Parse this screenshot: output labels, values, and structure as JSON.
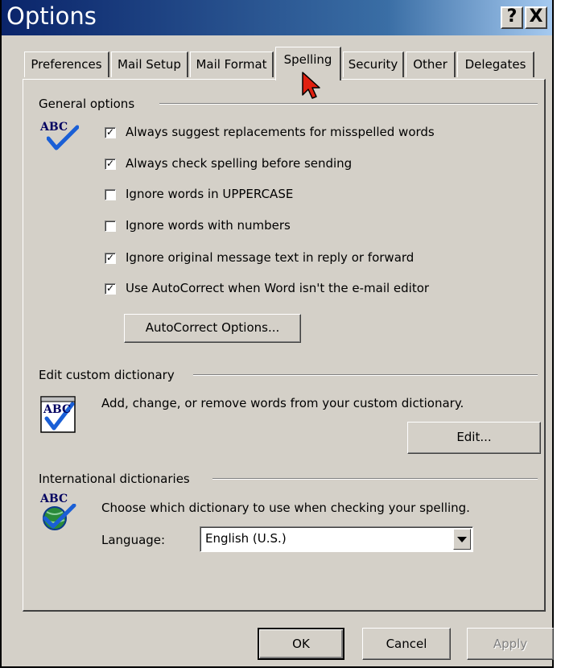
{
  "window": {
    "title": "Options",
    "help_label": "?",
    "close_label": "X"
  },
  "tabs": [
    {
      "label": "Preferences"
    },
    {
      "label": "Mail Setup"
    },
    {
      "label": "Mail Format"
    },
    {
      "label": "Spelling"
    },
    {
      "label": "Security"
    },
    {
      "label": "Other"
    },
    {
      "label": "Delegates"
    }
  ],
  "active_tab": "Spelling",
  "general_options": {
    "title": "General options",
    "icon_text": "ABC",
    "checkboxes": [
      {
        "label": "Always suggest replacements for misspelled words",
        "checked": true
      },
      {
        "label": "Always check spelling before sending",
        "checked": true
      },
      {
        "label": "Ignore words in UPPERCASE",
        "checked": false
      },
      {
        "label": "Ignore words with numbers",
        "checked": false
      },
      {
        "label": "Ignore original message text in reply or forward",
        "checked": true
      },
      {
        "label": "Use AutoCorrect when Word isn't the e-mail editor",
        "checked": true
      }
    ],
    "autocorrect_button": "AutoCorrect Options..."
  },
  "custom_dictionary": {
    "title": "Edit custom dictionary",
    "icon_text": "ABC",
    "description": "Add, change, or remove words from your custom dictionary.",
    "edit_button": "Edit..."
  },
  "international": {
    "title": "International dictionaries",
    "icon_text": "ABC",
    "description": "Choose which dictionary to use when checking your spelling.",
    "language_label": "Language:",
    "language_value": "English (U.S.)"
  },
  "footer": {
    "ok": "OK",
    "cancel": "Cancel",
    "apply": "Apply"
  },
  "colors": {
    "titlebar": "#0a246a",
    "face": "#d4d0c8",
    "cursor": "#e02010",
    "check": "#1a5fd6"
  }
}
